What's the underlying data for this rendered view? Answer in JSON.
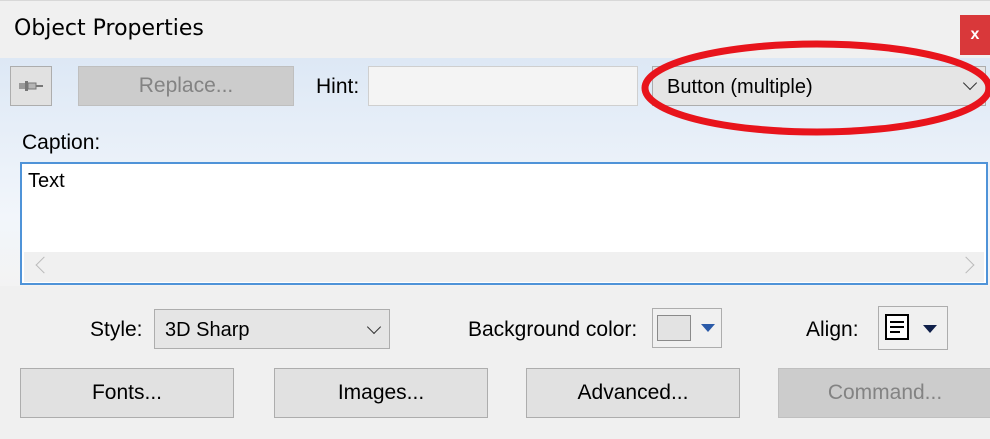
{
  "window": {
    "title": "Object Properties",
    "close_label": "x"
  },
  "toolbar": {
    "pin_icon": "pushpin-icon",
    "replace_label": "Replace...",
    "hint_label": "Hint:",
    "hint_value": "",
    "object_type_value": "Button (multiple)",
    "highlight_color": "#e8141c"
  },
  "caption": {
    "label": "Caption:",
    "value": "Text"
  },
  "style": {
    "label": "Style:",
    "value": "3D Sharp"
  },
  "background_color": {
    "label": "Background color:",
    "swatch": "#e3e3e3",
    "arrow_color": "#2a5aa8"
  },
  "align": {
    "label": "Align:",
    "icon": "align-left-icon"
  },
  "buttons": {
    "fonts": "Fonts...",
    "images": "Images...",
    "advanced": "Advanced...",
    "command": "Command..."
  }
}
